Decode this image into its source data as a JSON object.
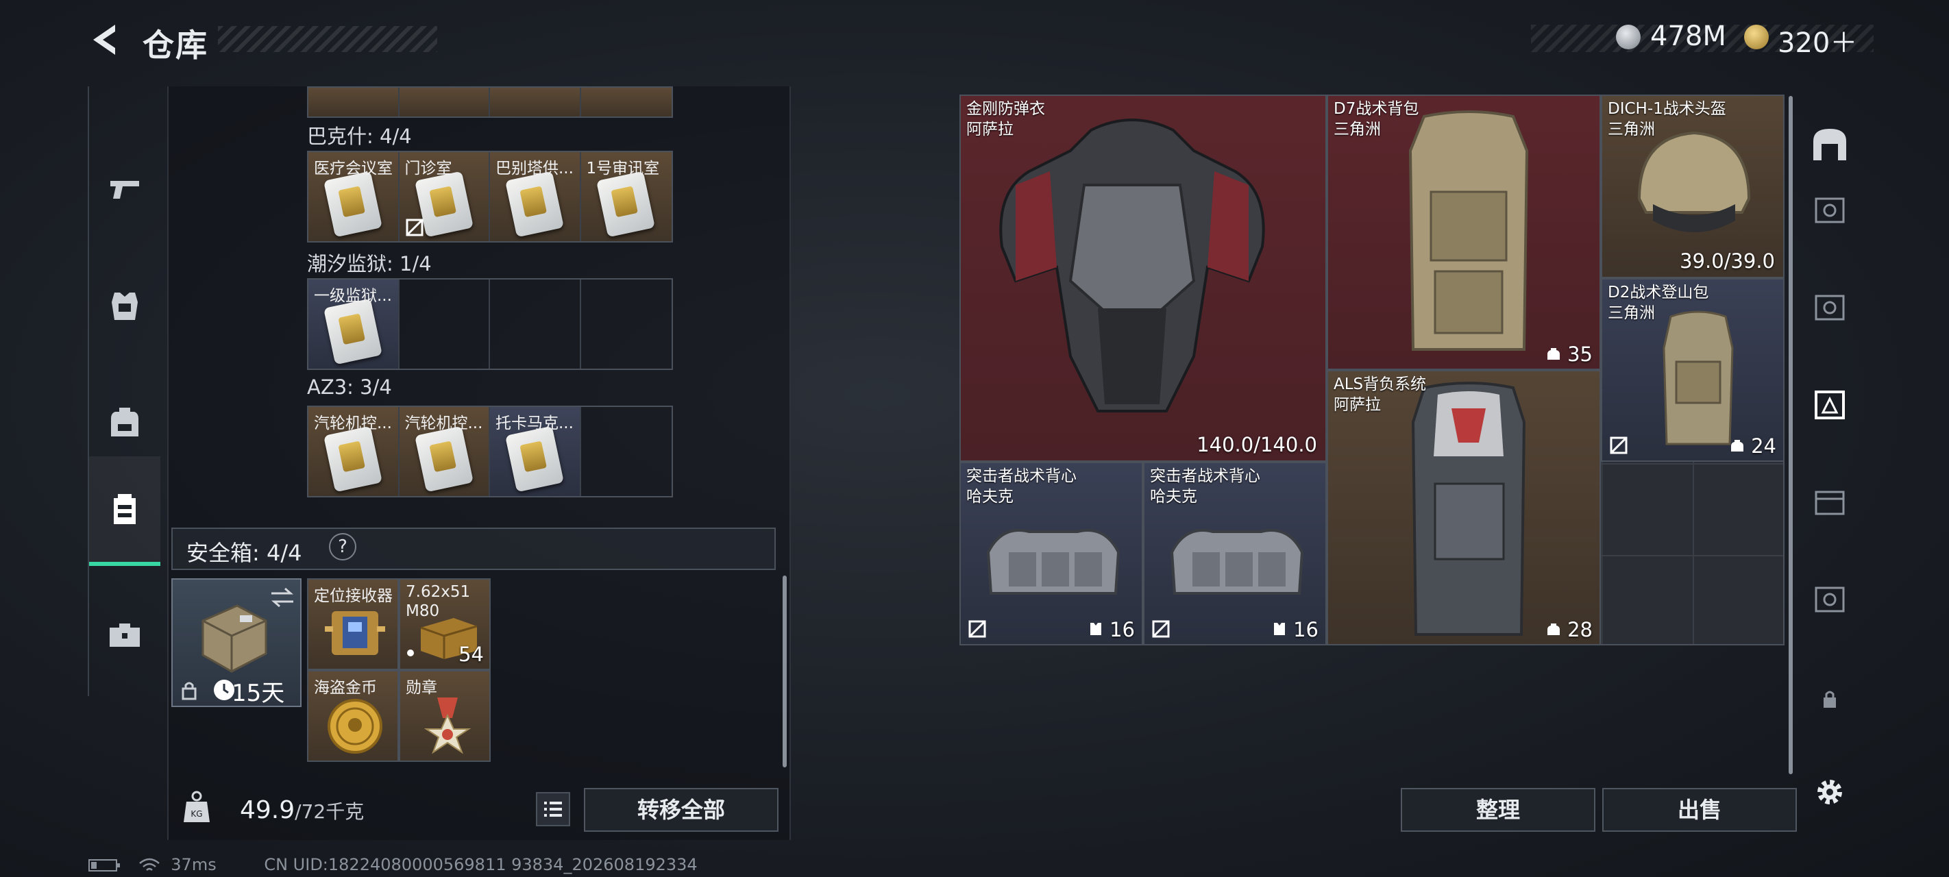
{
  "header": {
    "title": "仓库",
    "currency_silver": "478M",
    "currency_gold": "320＋"
  },
  "left_nav": {
    "items": [
      "weapon",
      "armor",
      "backpack",
      "safebox",
      "toolkit"
    ],
    "active": 3
  },
  "collections": [
    {
      "label": "巴克什: 4/4",
      "slots": [
        {
          "name": "医疗会议室",
          "style": "brown"
        },
        {
          "name": "门诊室",
          "style": "brown",
          "noflag": true
        },
        {
          "name": "巴别塔供...",
          "style": "brown"
        },
        {
          "name": "1号审讯室",
          "style": "brown"
        }
      ]
    },
    {
      "label": "潮汐监狱: 1/4",
      "slots": [
        {
          "name": "一级监狱...",
          "style": "blue"
        },
        {
          "name": ""
        },
        {
          "name": ""
        },
        {
          "name": ""
        }
      ]
    },
    {
      "label": "AZ3: 3/4",
      "slots": [
        {
          "name": "汽轮机控...",
          "style": "brown"
        },
        {
          "name": "汽轮机控...",
          "style": "brown"
        },
        {
          "name": "托卡马克...",
          "style": "blue"
        },
        {
          "name": ""
        }
      ]
    }
  ],
  "safebox": {
    "title": "安全箱: 4/4",
    "help": "?",
    "days": "15天",
    "items": [
      {
        "name": "定位接收器"
      },
      {
        "name": "7.62x51 M80",
        "count": "54"
      },
      {
        "name": "海盗金币"
      },
      {
        "name": "勋章"
      }
    ]
  },
  "bottom": {
    "weight": "49.9",
    "weight_max": "/72千克",
    "transfer_all": "转移全部"
  },
  "grid_items": [
    {
      "id": "armor",
      "name": "金刚防弹衣",
      "maker": "阿萨拉",
      "value": "140.0/140.0"
    },
    {
      "id": "d7",
      "name": "D7战术背包",
      "maker": "三角洲",
      "value": "35"
    },
    {
      "id": "helmet",
      "name": "DICH-1战术头盔",
      "maker": "三角洲",
      "value": "39.0/39.0"
    },
    {
      "id": "d2",
      "name": "D2战术登山包",
      "maker": "三角洲",
      "value": "24"
    },
    {
      "id": "als",
      "name": "ALS背负系统",
      "maker": "阿萨拉",
      "value": "28"
    },
    {
      "id": "vest1",
      "name": "突击者战术背心",
      "maker": "哈夫克",
      "value": "16"
    },
    {
      "id": "vest2",
      "name": "突击者战术背心",
      "maker": "哈夫克",
      "value": "16"
    }
  ],
  "actions": {
    "sort": "整理",
    "sell": "出售"
  },
  "status": {
    "ping": "37ms",
    "uid": "CN UID:18224080000569811 93834_202608192334"
  },
  "colors": {
    "accent": "#38d6a2",
    "red_slot": "#5a262c",
    "brown_slot": "#554535",
    "blue_slot": "#3a4055"
  }
}
